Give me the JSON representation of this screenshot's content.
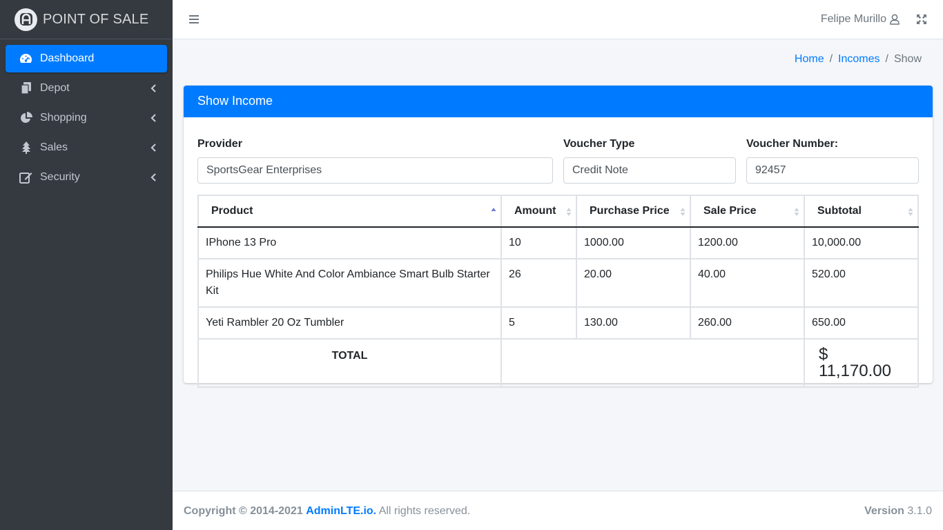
{
  "brand": {
    "title": "POINT OF SALE",
    "logo_icon": "letter-a-logo-icon"
  },
  "sidebar": {
    "items": [
      {
        "label": "Dashboard",
        "icon": "tachometer-icon",
        "active": true
      },
      {
        "label": "Depot",
        "icon": "copy-icon"
      },
      {
        "label": "Shopping",
        "icon": "pie-chart-icon"
      },
      {
        "label": "Sales",
        "icon": "tree-icon"
      },
      {
        "label": "Security",
        "icon": "edit-icon"
      }
    ]
  },
  "topbar": {
    "user_name": "Felipe Murillo",
    "user_icon": "user-icon",
    "fullscreen_icon": "expand-arrows-icon",
    "menu_icon": "hamburger-icon"
  },
  "breadcrumb": {
    "home": "Home",
    "incomes": "Incomes",
    "current": "Show",
    "separator": "/"
  },
  "card": {
    "title": "Show Income",
    "provider_label": "Provider",
    "provider_value": "SportsGear Enterprises",
    "voucher_type_label": "Voucher Type",
    "voucher_type_value": "Credit Note",
    "voucher_number_label": "Voucher Number:",
    "voucher_number_value": "92457"
  },
  "table": {
    "headers": [
      "Product",
      "Amount",
      "Purchase Price",
      "Sale Price",
      "Subtotal"
    ],
    "rows": [
      [
        "IPhone 13 Pro",
        "10",
        "1000.00",
        "1200.00",
        "10,000.00"
      ],
      [
        "Philips Hue White And Color Ambiance Smart Bulb Starter Kit",
        "26",
        "20.00",
        "40.00",
        "520.00"
      ],
      [
        "Yeti Rambler 20 Oz Tumbler",
        "5",
        "130.00",
        "260.00",
        "650.00"
      ]
    ],
    "total_label": "TOTAL",
    "total_value": "$ 11,170.00"
  },
  "footer": {
    "copyright_prefix": "Copyright © 2014-2021",
    "link": "AdminLTE.io.",
    "suffix": "All rights reserved.",
    "version_label": "Version",
    "version_value": "3.1.0"
  },
  "colors": {
    "primary": "#007bff",
    "sidebar": "#343a40",
    "background": "#f4f6f9"
  }
}
